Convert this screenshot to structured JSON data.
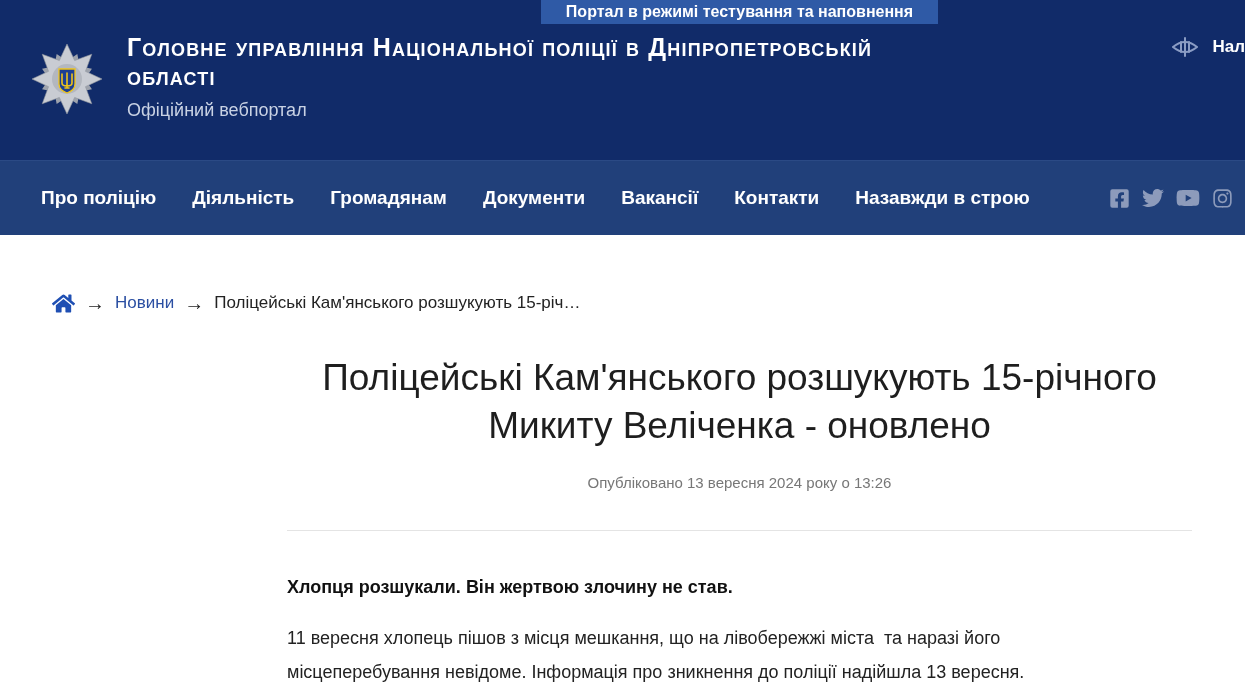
{
  "banner": {
    "text": "Портал в режимі тестування та наповнення"
  },
  "header": {
    "title": "Головне управління Національної поліції в Дніпропетровській області",
    "subtitle": "Офіційний вебпортал",
    "accessibility_link": "Нал"
  },
  "nav": {
    "items": [
      {
        "label": "Про поліцію"
      },
      {
        "label": "Діяльність"
      },
      {
        "label": "Громадянам"
      },
      {
        "label": "Документи"
      },
      {
        "label": "Вакансії"
      },
      {
        "label": "Контакти"
      },
      {
        "label": "Назавжди в строю"
      }
    ]
  },
  "breadcrumb": [
    {
      "kind": "home"
    },
    {
      "kind": "separator",
      "text": "→"
    },
    {
      "kind": "link",
      "text": "Новини"
    },
    {
      "kind": "separator",
      "text": "→"
    },
    {
      "kind": "current",
      "text": "Поліцейські Кам'янського розшукують 15-річ…"
    }
  ],
  "article": {
    "title": "Поліцейські Кам'янського розшукують 15-річного Микиту Веліченка - оновлено",
    "published": "Опубліковано 13 вересня 2024 року о 13:26",
    "paragraphs": [
      {
        "kind": "lead",
        "text": "Хлопця розшукали. Він жертвою злочину не став."
      },
      {
        "kind": "body",
        "text": "11 вересня хлопець пішов з місця мешкання, що на лівобережжі міста  та наразі його місцеперебування невідоме. Інформація про зникнення до поліції надійшла 13 вересня."
      }
    ]
  }
}
